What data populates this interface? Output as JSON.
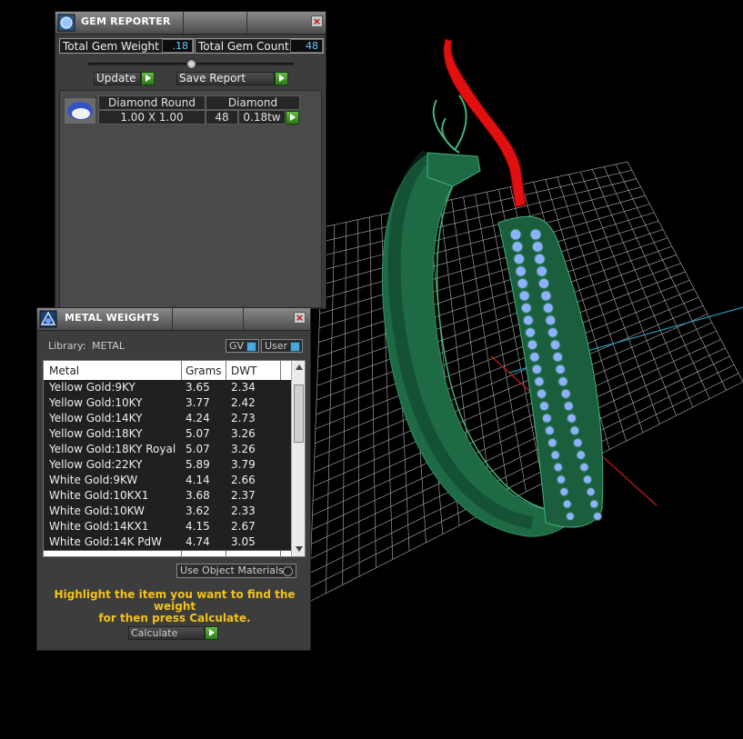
{
  "gem_reporter": {
    "title": "GEM REPORTER",
    "total_weight_label": "Total Gem Weight",
    "total_weight_value": ".18",
    "total_count_label": "Total Gem Count",
    "total_count_value": "48",
    "update_label": "Update",
    "save_report_label": "Save Report",
    "gem": {
      "shape": "Diamond Round",
      "material": "Diamond",
      "size": "1.00 X 1.00",
      "count": "48",
      "weight": "0.18tw"
    }
  },
  "metal_weights": {
    "title": "METAL WEIGHTS",
    "library_label": "Library:",
    "library_value": "METAL",
    "toggle_gv": "GV",
    "toggle_user": "User",
    "columns": [
      "Metal",
      "Grams",
      "DWT"
    ],
    "rows": [
      {
        "metal": "Yellow Gold:9KY",
        "grams": "3.65",
        "dwt": "2.34"
      },
      {
        "metal": "Yellow Gold:10KY",
        "grams": "3.77",
        "dwt": "2.42"
      },
      {
        "metal": "Yellow Gold:14KY",
        "grams": "4.24",
        "dwt": "2.73"
      },
      {
        "metal": "Yellow Gold:18KY",
        "grams": "5.07",
        "dwt": "3.26"
      },
      {
        "metal": "Yellow Gold:18KY Royal",
        "grams": "5.07",
        "dwt": "3.26"
      },
      {
        "metal": "Yellow Gold:22KY",
        "grams": "5.89",
        "dwt": "3.79"
      },
      {
        "metal": "White Gold:9KW",
        "grams": "4.14",
        "dwt": "2.66"
      },
      {
        "metal": "White Gold:10KX1",
        "grams": "3.68",
        "dwt": "2.37"
      },
      {
        "metal": "White Gold:10KW",
        "grams": "3.62",
        "dwt": "2.33"
      },
      {
        "metal": "White Gold:14KX1",
        "grams": "4.15",
        "dwt": "2.67"
      },
      {
        "metal": "White Gold:14K PdW",
        "grams": "4.74",
        "dwt": "3.05"
      }
    ],
    "use_object_materials_label": "Use Object Materials",
    "hint_line1": "Highlight the item you want to find the weight",
    "hint_line2": "for then press Calculate.",
    "calculate_label": "Calculate"
  },
  "colors": {
    "ring_green": "#1f6b47",
    "sprue_red": "#e01010",
    "gem_blue": "#8fb0ff",
    "hint_yellow": "#f2c21b",
    "value_blue": "#5fc8ff"
  }
}
